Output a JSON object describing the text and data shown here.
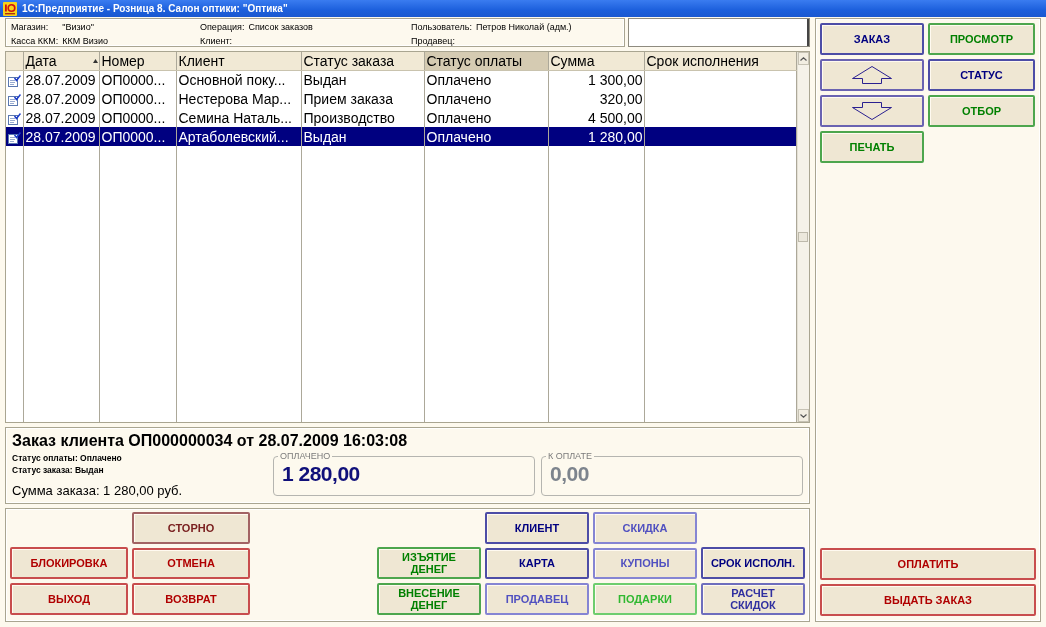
{
  "window": {
    "title": "1С:Предприятие - Розница 8. Салон оптики: \"Оптика\""
  },
  "info_bar": {
    "groups": [
      {
        "fields": [
          {
            "label": "Магазин:",
            "value": "\"Визио\""
          },
          {
            "label": "Касса ККМ:",
            "value": "ККМ Визио"
          }
        ]
      },
      {
        "fields": [
          {
            "label": "Операция:",
            "value": "Список заказов"
          },
          {
            "label": "Клиент:"
          }
        ]
      },
      {
        "fields": [
          {
            "label": "Пользователь:",
            "value": "Петров Николай (адм.)"
          },
          {
            "label": "Продавец:"
          }
        ]
      }
    ]
  },
  "orders_table": {
    "columns": [
      {
        "label": "Дата",
        "kind": "text",
        "sorted": true,
        "selected": false
      },
      {
        "label": "Номер",
        "kind": "text",
        "sorted": false,
        "selected": false
      },
      {
        "label": "Клиент",
        "kind": "text",
        "sorted": false,
        "selected": false
      },
      {
        "label": "Статус заказа",
        "kind": "text",
        "sorted": false,
        "selected": false
      },
      {
        "label": "Статус оплаты",
        "kind": "text",
        "sorted": false,
        "selected": true
      },
      {
        "label": "Сумма",
        "kind": "money",
        "sorted": false,
        "selected": false
      },
      {
        "label": "Срок исполнения",
        "kind": "text",
        "sorted": false,
        "selected": false
      }
    ],
    "rows": [
      {
        "selected": false,
        "cells": [
          "28.07.2009",
          "ОП0000...",
          "Основной поку...",
          "Выдан",
          "Оплачено",
          "1 300,00"
        ]
      },
      {
        "selected": false,
        "cells": [
          "28.07.2009",
          "ОП0000...",
          "Нестерова Мар...",
          "Прием заказа",
          "Оплачено",
          "320,00"
        ]
      },
      {
        "selected": false,
        "cells": [
          "28.07.2009",
          "ОП0000...",
          "Семина Наталь...",
          "Производство",
          "Оплачено",
          "4 500,00"
        ]
      },
      {
        "selected": true,
        "cells": [
          "28.07.2009",
          "ОП0000...",
          "Артаболевский...",
          "Выдан",
          "Оплачено",
          "1 280,00"
        ]
      }
    ]
  },
  "order_details": {
    "title": "Заказ клиента ОП000000034 от 28.07.2009 16:03:08",
    "lines": [
      "Статус оплаты: Оплачено",
      "Статус заказа: Выдан"
    ],
    "total": "Сумма заказа: 1 280,00 руб.",
    "amounts": [
      {
        "label": "ОПЛАЧЕНО",
        "value": "1 280,00",
        "disabled": false
      },
      {
        "label": "К ОПЛАТЕ",
        "value": "0,00",
        "disabled": true
      }
    ]
  },
  "action_panel": {
    "groups": [
      {
        "columns": [
          {
            "buttons": [
              {
                "label": "БЛОКИРОВКА",
                "color": "#b00000"
              },
              {
                "label": "ВЫХОД",
                "color": "#b00000"
              }
            ]
          },
          {
            "buttons": [
              {
                "label": "СТОРНО",
                "color": "#7a2020"
              },
              {
                "label": "ОТМЕНА",
                "color": "#b00000"
              },
              {
                "label": "ВОЗВРАТ",
                "color": "#b00000"
              }
            ]
          }
        ]
      },
      {
        "columns": [
          {
            "buttons": [
              {
                "label": "ИЗЪЯТИЕ\nДЕНЕГ",
                "color": "#008000"
              },
              {
                "label": "ВНЕСЕНИЕ\nДЕНЕГ",
                "color": "#008000"
              }
            ]
          },
          {
            "buttons": [
              {
                "label": "КЛИЕНТ",
                "color": "#000080"
              },
              {
                "label": "КАРТА",
                "color": "#000080"
              },
              {
                "label": "ПРОДАВЕЦ",
                "color": "#5050c0"
              }
            ]
          },
          {
            "buttons": [
              {
                "label": "СКИДКА",
                "color": "#5050c0"
              },
              {
                "label": "КУПОНЫ",
                "color": "#5050c0"
              },
              {
                "label": "ПОДАРКИ",
                "color": "#30b830"
              }
            ]
          },
          {
            "buttons": [
              {
                "label": "СРОК ИСПОЛН.",
                "color": "#000080"
              },
              {
                "label": "РАСЧЕТ\nСКИДОК",
                "color": "#3030a0"
              }
            ]
          }
        ]
      }
    ]
  },
  "side_panel": {
    "top_buttons": [
      {
        "kind": "text",
        "label": "ЗАКАЗ",
        "color": "#000080"
      },
      {
        "kind": "text",
        "label": "ПРОСМОТР",
        "color": "#008000"
      },
      {
        "kind": "up",
        "color": "#2a2090"
      },
      {
        "kind": "text",
        "label": "СТАТУС",
        "color": "#000080"
      },
      {
        "kind": "down",
        "color": "#2a2090"
      },
      {
        "kind": "text",
        "label": "ОТБОР",
        "color": "#008000"
      },
      {
        "kind": "text",
        "label": "ПЕЧАТЬ",
        "color": "#008000"
      }
    ],
    "bottom_buttons": [
      {
        "label": "ОПЛАТИТЬ",
        "color": "#b00000"
      },
      {
        "label": "ВЫДАТЬ ЗАКАЗ",
        "color": "#b00000"
      }
    ]
  }
}
